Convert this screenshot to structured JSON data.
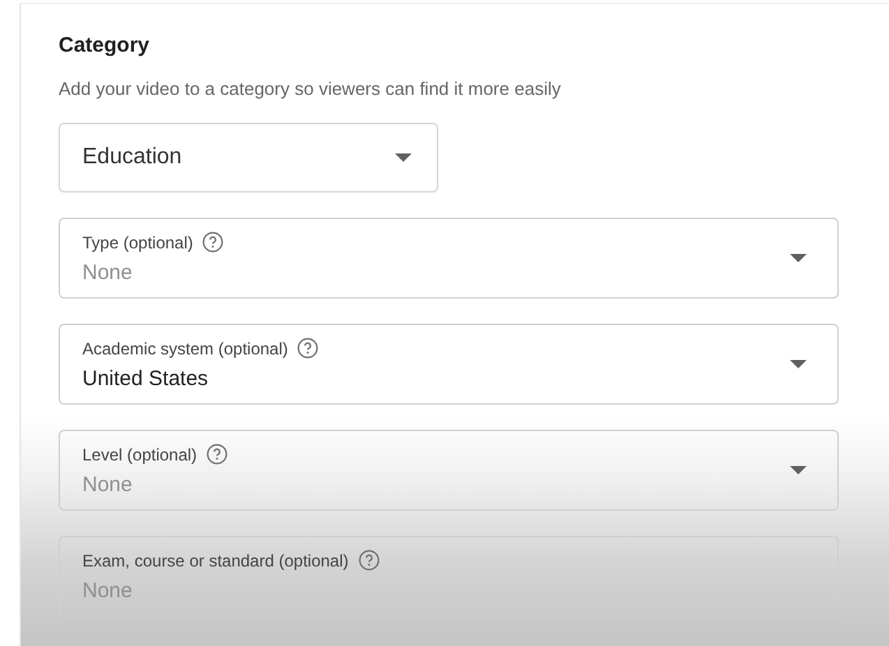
{
  "section": {
    "title": "Category",
    "description": "Add your video to a category so viewers can find it more easily"
  },
  "category_select": {
    "value": "Education"
  },
  "fields": [
    {
      "kind": "dropdown",
      "label": "Type (optional)",
      "placeholder": "None"
    },
    {
      "kind": "dropdown",
      "label": "Academic system (optional)",
      "value": "United States"
    },
    {
      "kind": "dropdown",
      "label": "Level (optional)",
      "placeholder": "None"
    },
    {
      "kind": "text",
      "label": "Exam, course or standard (optional)",
      "placeholder": "None"
    }
  ]
}
